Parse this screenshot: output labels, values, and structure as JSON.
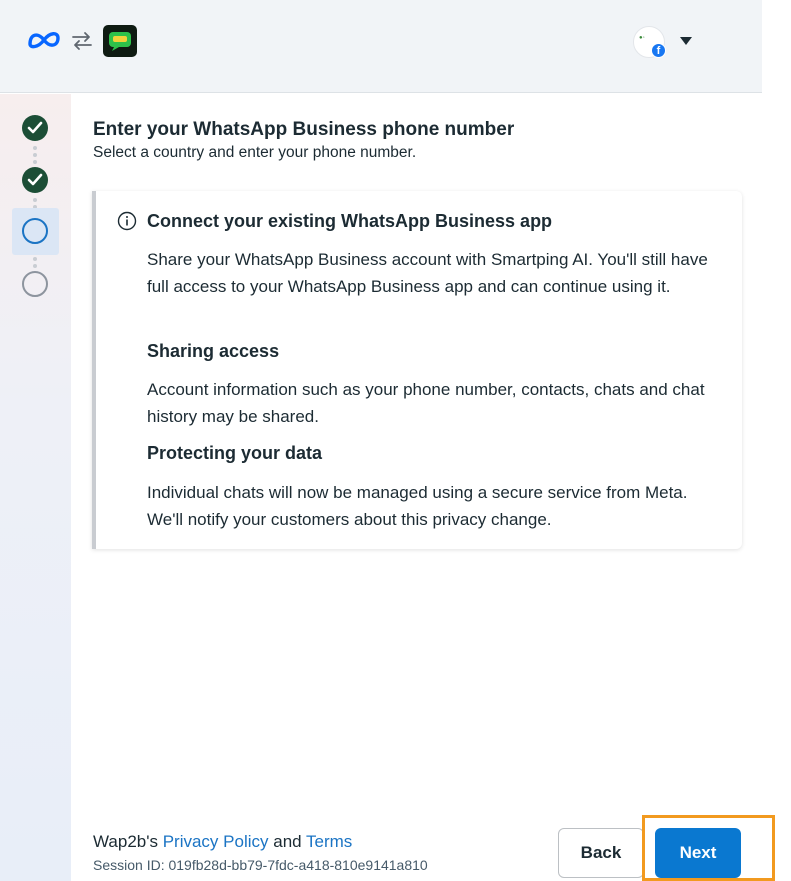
{
  "header": {
    "meta_logo_icon": "meta-infinity-icon",
    "swap_icon": "swap-arrows-icon",
    "app_icon": "chat-bubble-app-icon",
    "account_avatar_icon": "facebook-badge-icon",
    "account_menu_icon": "caret-down-icon"
  },
  "stepper": {
    "steps": [
      {
        "state": "completed"
      },
      {
        "state": "completed"
      },
      {
        "state": "active"
      },
      {
        "state": "pending"
      }
    ]
  },
  "main": {
    "title": "Enter your WhatsApp Business phone number",
    "subtitle": "Select a country and enter your phone number."
  },
  "info_card": {
    "icon": "info-circle-icon",
    "heading": "Connect your existing WhatsApp Business app",
    "paragraph_1": "Share your WhatsApp Business account with Smartping AI. You'll still have full access to your WhatsApp Business app and can continue using it.",
    "sharing_heading": "Sharing access",
    "sharing_text": "Account information such as your phone number, contacts, chats and chat history may be shared.",
    "protecting_heading": "Protecting your data",
    "protecting_text": "Individual chats will now be managed using a secure service from Meta. We'll notify your customers about this privacy change."
  },
  "footer": {
    "prefix": "Wap2b's ",
    "privacy_policy": "Privacy Policy",
    "and": " and ",
    "terms": "Terms",
    "session_label": "Session ID: 019fb28d-bb79-7fdc-a418-810e9141a810",
    "back_label": "Back",
    "next_label": "Next"
  },
  "colors": {
    "primary": "#0a78d0",
    "link": "#1b74c4",
    "step_done": "#1c4e36",
    "highlight": "#f29a1f"
  }
}
